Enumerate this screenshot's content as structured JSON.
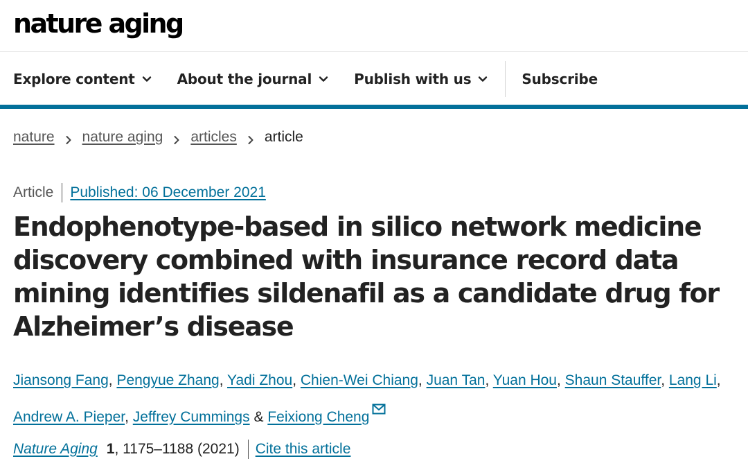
{
  "site": {
    "logo_text": "nature aging"
  },
  "nav": {
    "items": [
      {
        "label": "Explore content",
        "icon": "chevron-down-icon"
      },
      {
        "label": "About the journal",
        "icon": "chevron-down-icon"
      },
      {
        "label": "Publish with us",
        "icon": "chevron-down-icon"
      }
    ],
    "subscribe_label": "Subscribe"
  },
  "breadcrumb": {
    "items": [
      "nature",
      "nature aging",
      "articles"
    ],
    "current": "article",
    "separator_icon": "chevron-right-icon"
  },
  "article": {
    "type": "Article",
    "published": "Published: 06 December 2021",
    "title": "Endophenotype-based in silico network medicine discovery combined with insurance record data mining identifies sildenafil as a candidate drug for Alzheimer’s disease",
    "authors": [
      "Jiansong Fang",
      "Pengyue Zhang",
      "Yadi Zhou",
      "Chien-Wei Chiang",
      "Juan Tan",
      "Yuan Hou",
      "Shaun Stauffer",
      "Lang Li",
      "Andrew A. Pieper",
      "Jeffrey Cummings",
      "Feixiong Cheng"
    ],
    "author_separator": ", ",
    "last_author_joiner": " & ",
    "corresponding_icon": "mail-icon",
    "citation": {
      "journal": "Nature Aging",
      "volume": "1",
      "pages_year": ", 1175–1188 (2021)",
      "cite_label": "Cite this article"
    }
  },
  "colors": {
    "link": "#02709a",
    "accent_bar": "#02709a",
    "text": "#222222",
    "muted": "#555555"
  }
}
